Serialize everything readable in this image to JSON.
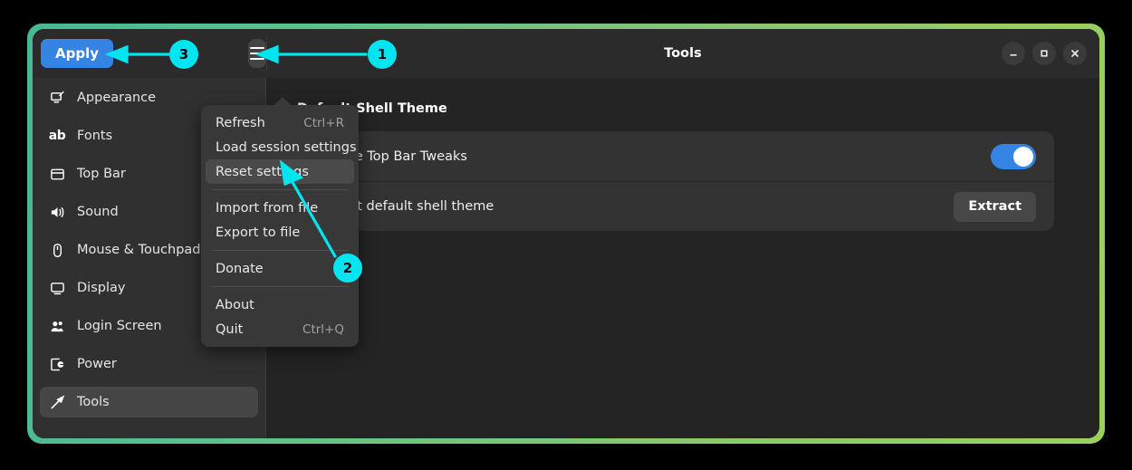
{
  "window": {
    "title": "Tools",
    "controls": [
      {
        "name": "minimize",
        "glyph": "minimize-icon"
      },
      {
        "name": "maximize",
        "glyph": "maximize-icon"
      },
      {
        "name": "close",
        "glyph": "close-icon"
      }
    ]
  },
  "header": {
    "apply_label": "Apply",
    "menu_button_icon": "hamburger-menu-icon"
  },
  "sidebar": {
    "items": [
      {
        "label": "Appearance",
        "icon": "appearance-icon",
        "selected": false
      },
      {
        "label": "Fonts",
        "icon": "fonts-ab-icon",
        "selected": false
      },
      {
        "label": "Top Bar",
        "icon": "top-bar-icon",
        "selected": false
      },
      {
        "label": "Sound",
        "icon": "sound-icon",
        "selected": false
      },
      {
        "label": "Mouse & Touchpad",
        "icon": "mouse-icon",
        "selected": false
      },
      {
        "label": "Display",
        "icon": "display-icon",
        "selected": false
      },
      {
        "label": "Login Screen",
        "icon": "login-screen-icon",
        "selected": false
      },
      {
        "label": "Power",
        "icon": "power-icon",
        "selected": false
      },
      {
        "label": "Tools",
        "icon": "tools-hammer-icon",
        "selected": true
      }
    ]
  },
  "main": {
    "section_title": "Default Shell Theme",
    "rows": [
      {
        "label": "Include Top Bar Tweaks",
        "control": "toggle",
        "toggle_on": true
      },
      {
        "label": "Extract default shell theme",
        "control": "button",
        "button_label": "Extract"
      }
    ]
  },
  "menu": {
    "items": [
      {
        "label": "Refresh",
        "accel": "Ctrl+R",
        "highlighted": false,
        "sep_after": false
      },
      {
        "label": "Load session settings",
        "accel": "",
        "highlighted": false,
        "sep_after": false
      },
      {
        "label": "Reset settings",
        "accel": "",
        "highlighted": true,
        "sep_after": true
      },
      {
        "label": "Import from file",
        "accel": "",
        "highlighted": false,
        "sep_after": false
      },
      {
        "label": "Export to file",
        "accel": "",
        "highlighted": false,
        "sep_after": true
      },
      {
        "label": "Donate",
        "accel": "",
        "highlighted": false,
        "sep_after": true
      },
      {
        "label": "About",
        "accel": "",
        "highlighted": false,
        "sep_after": false
      },
      {
        "label": "Quit",
        "accel": "Ctrl+Q",
        "highlighted": false,
        "sep_after": false
      }
    ]
  },
  "annotations": {
    "accent_color": "#00e5ef",
    "markers": [
      {
        "label": "1",
        "target": "hamburger-menu-button"
      },
      {
        "label": "2",
        "target": "menu-item-reset-settings"
      },
      {
        "label": "3",
        "target": "apply-button"
      }
    ]
  },
  "colors": {
    "accent_blue": "#3584e4",
    "window_bg": "#242424",
    "sidebar_bg": "#303030",
    "menu_bg": "#383838",
    "frame_gradient_start": "#49b795",
    "frame_gradient_end": "#9ad05e"
  }
}
